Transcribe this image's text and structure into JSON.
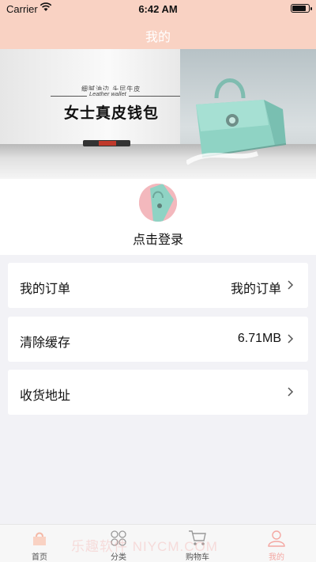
{
  "status_bar": {
    "carrier": "Carrier",
    "time": "6:42 AM"
  },
  "nav": {
    "title": "我的"
  },
  "banner": {
    "small_text": "细腻油边  头层牛皮",
    "english_text": "Leather wallet",
    "title": "女士真皮钱包"
  },
  "profile": {
    "login_text": "点击登录"
  },
  "menu": [
    {
      "label": "我的订单",
      "value": "我的订单"
    },
    {
      "label": "清除缓存",
      "value": "6.71MB"
    },
    {
      "label": "收货地址",
      "value": ""
    }
  ],
  "tabs": [
    {
      "label": "首页",
      "icon": "home-icon"
    },
    {
      "label": "分类",
      "icon": "category-icon"
    },
    {
      "label": "购物车",
      "icon": "cart-icon"
    },
    {
      "label": "我的",
      "icon": "person-icon",
      "active": true
    }
  ],
  "watermark": "乐趣软件 NIYCM.COM",
  "colors": {
    "accent": "#f4a7a2",
    "header": "#f9d2c3",
    "background": "#f2f2f6"
  }
}
